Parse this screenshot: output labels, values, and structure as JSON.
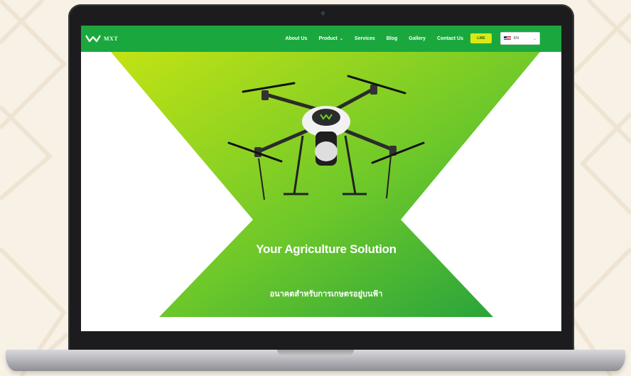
{
  "nav": {
    "logo_text": "MXT",
    "links": [
      {
        "label": "About Us"
      },
      {
        "label": "Product",
        "has_dropdown": true
      },
      {
        "label": "Services"
      },
      {
        "label": "Blog"
      },
      {
        "label": "Gallery"
      },
      {
        "label": "Contact Us"
      }
    ],
    "cta_label": "LINE",
    "language": "EN"
  },
  "hero": {
    "title": "Your  Agriculture Solution",
    "subtitle": "อนาคตสำหรับการเกษตรอยู่บนฟ้า"
  },
  "colors": {
    "nav_green": "#1aa83e",
    "hero_green_light": "#b6df16",
    "hero_green_dark": "#25a23a",
    "cta_yellow": "#d8ea16"
  }
}
